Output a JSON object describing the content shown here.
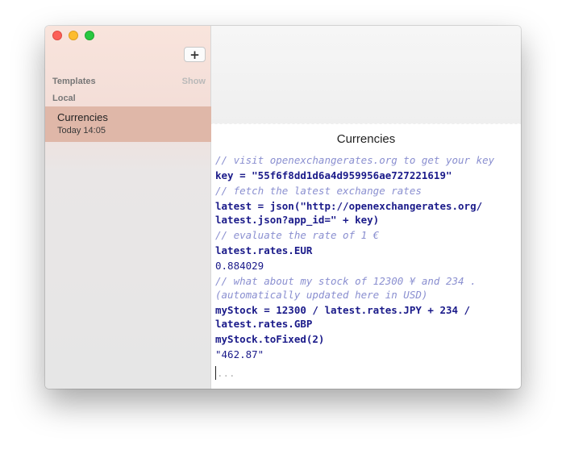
{
  "sidebar": {
    "add_label": "+",
    "templates_label": "Templates",
    "show_label": "Show",
    "local_label": "Local",
    "document": {
      "title": "Currencies",
      "time": "Today 14:05"
    }
  },
  "editor": {
    "title": "Currencies",
    "lines": [
      {
        "kind": "comment",
        "text": "// visit openexchangerates.org to get your key"
      },
      {
        "kind": "code",
        "text": "key = \"55f6f8dd1d6a4d959956ae727221619\""
      },
      {
        "kind": "comment",
        "text": "// fetch the latest exchange rates"
      },
      {
        "kind": "code",
        "text": "latest = json(\"http://openexchangerates.org/\nlatest.json?app_id=\" + key)"
      },
      {
        "kind": "comment",
        "text": "// evaluate the rate of 1 €"
      },
      {
        "kind": "code",
        "text": "latest.rates.EUR"
      },
      {
        "kind": "result",
        "text": "0.884029"
      },
      {
        "kind": "comment",
        "text": "// what about my stock of 12300 ¥ and 234 .\n(automatically updated here in USD)"
      },
      {
        "kind": "code",
        "text": "myStock = 12300 / latest.rates.JPY + 234 /\nlatest.rates.GBP"
      },
      {
        "kind": "code",
        "text": "myStock.toFixed(2)"
      },
      {
        "kind": "result",
        "text": "\"462.87\""
      }
    ],
    "placeholder": "..."
  },
  "colors": {
    "comment": "#8a8fd0",
    "code": "#1b1b8a",
    "selection": "#dfb7a8"
  }
}
